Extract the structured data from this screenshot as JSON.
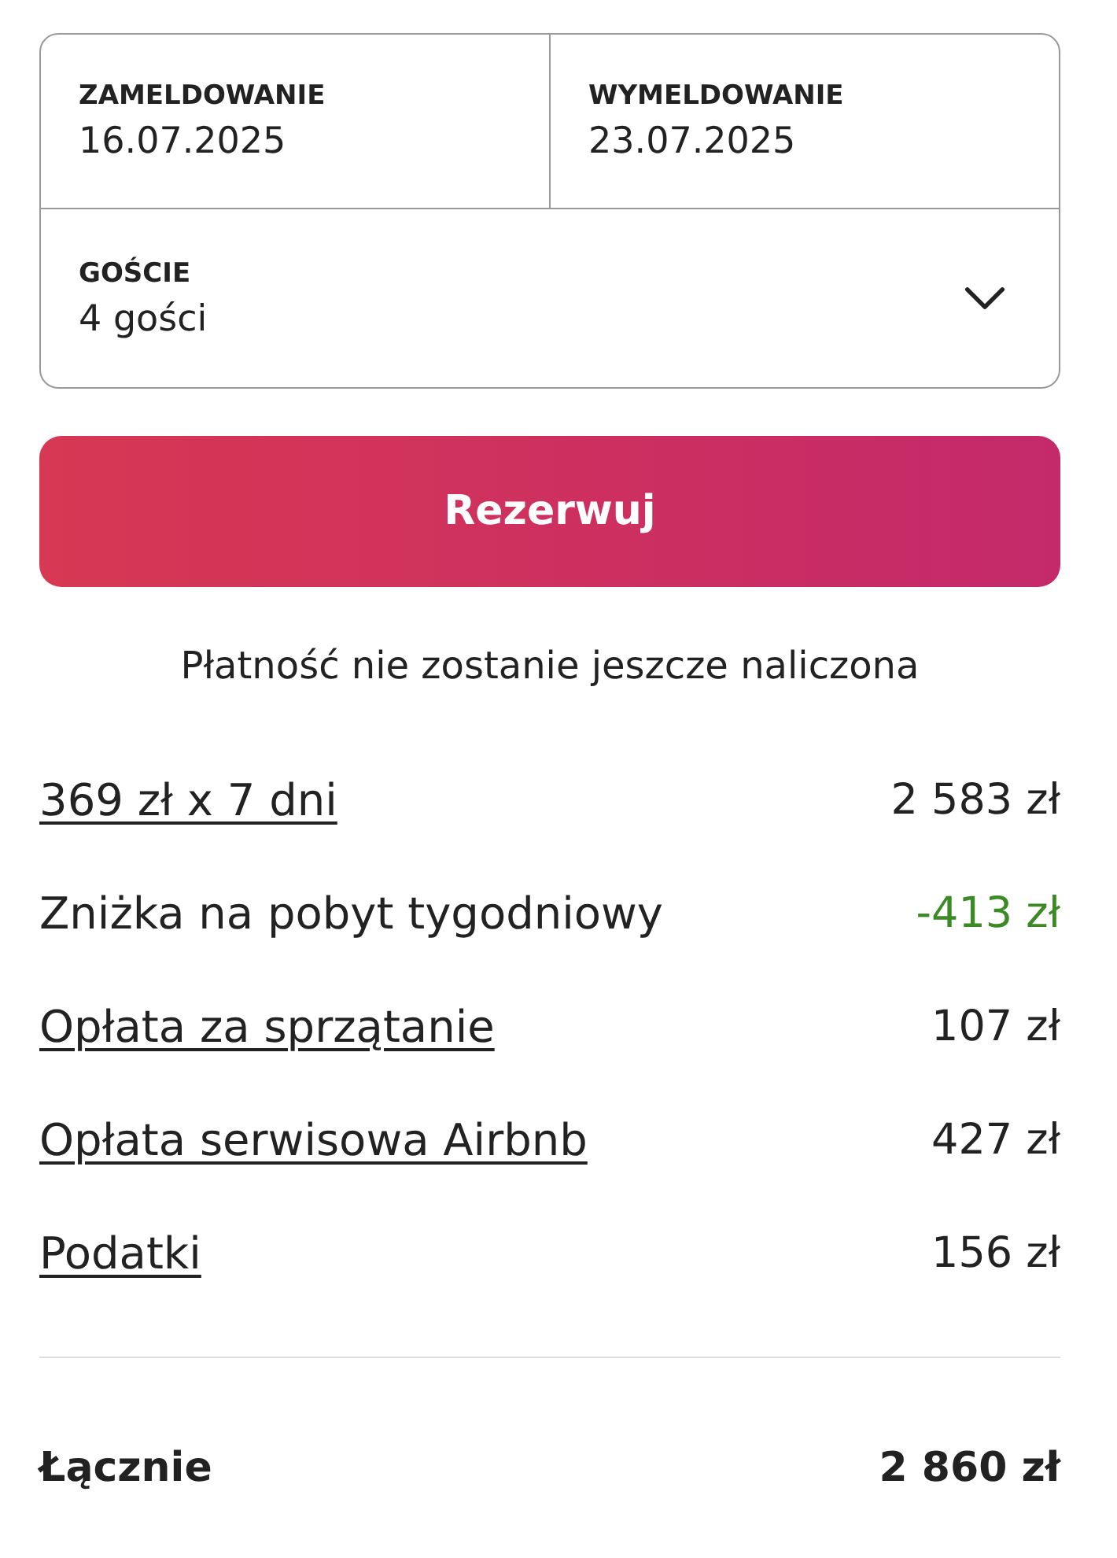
{
  "booking": {
    "dates": [
      {
        "label": "ZAMELDOWANIE",
        "value": "16.07.2025"
      },
      {
        "label": "WYMELDOWANIE",
        "value": "23.07.2025"
      }
    ],
    "guests": {
      "label": "GOŚCIE",
      "value": "4 gości"
    }
  },
  "reserve_button": {
    "label": "Rezerwuj"
  },
  "note": "Płatność nie zostanie jeszcze naliczona",
  "price_rows": [
    {
      "kind": "link",
      "label": "369 zł x 7 dni",
      "amount": "2 583 zł"
    },
    {
      "kind": "discount",
      "label": "Zniżka na pobyt tygodniowy",
      "amount": "-413 zł"
    },
    {
      "kind": "link",
      "label": "Opłata za sprzątanie",
      "amount": "107 zł"
    },
    {
      "kind": "link",
      "label": "Opłata serwisowa Airbnb",
      "amount": "427 zł"
    },
    {
      "kind": "link",
      "label": "Podatki",
      "amount": "156 zł"
    }
  ],
  "total": {
    "label": "Łącznie",
    "amount": "2 860 zł"
  }
}
